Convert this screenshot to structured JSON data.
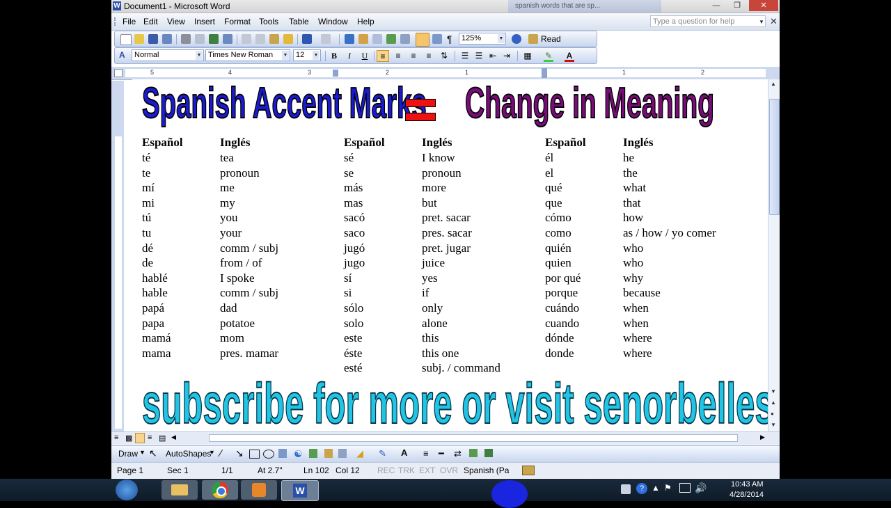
{
  "window": {
    "title": "Document1 - Microsoft Word",
    "bg_tab": "spanish words that are sp..."
  },
  "menu": {
    "items": [
      "File",
      "Edit",
      "View",
      "Insert",
      "Format",
      "Tools",
      "Table",
      "Window",
      "Help"
    ],
    "help_placeholder": "Type a question for help"
  },
  "standard_toolbar": {
    "zoom": "125%",
    "read_label": "Read"
  },
  "formatting_toolbar": {
    "style": "Normal",
    "font": "Times New Roman",
    "size": "12",
    "bold": "B",
    "italic": "I",
    "underline": "U"
  },
  "ruler": {
    "numbers": [
      "5",
      "4",
      "3",
      "2",
      "1",
      "1",
      "2"
    ]
  },
  "document": {
    "title_left": "Spanish Accent Marks",
    "title_right": "Change in Meaning",
    "headers": [
      "Español",
      "Inglés",
      "Español",
      "Inglés",
      "Español",
      "Inglés"
    ],
    "col1_es": [
      "té",
      "te",
      "mí",
      "mi",
      "tú",
      "tu",
      "dé",
      "de",
      "hablé",
      "hable",
      "papá",
      "papa",
      "mamá",
      "mama"
    ],
    "col1_en": [
      "tea",
      "pronoun",
      "me",
      "my",
      "you",
      "your",
      "comm / subj",
      "from / of",
      "I spoke",
      "comm / subj",
      "dad",
      "potatoe",
      "mom",
      "pres. mamar"
    ],
    "col2_es": [
      "sé",
      "se",
      "más",
      "mas",
      "sacó",
      "saco",
      "jugó",
      "jugo",
      "sí",
      "si",
      "sólo",
      "solo",
      "este",
      "éste",
      "esté"
    ],
    "col2_en": [
      "I know",
      "pronoun",
      "more",
      "but",
      "pret. sacar",
      "pres. sacar",
      "pret. jugar",
      "juice",
      "yes",
      "if",
      "only",
      "alone",
      "this",
      "this one",
      "subj. / command"
    ],
    "col3_es": [
      "él",
      "el",
      "qué",
      "que",
      "cómo",
      "como",
      "quién",
      "quien",
      "por qué",
      "porque",
      "cuándo",
      "cuando",
      "dónde",
      "donde"
    ],
    "col3_en": [
      "he",
      "the",
      "what",
      "that",
      "how",
      "as / how / yo comer",
      "who",
      "who",
      "why",
      "because",
      "when",
      "when",
      "where",
      "where"
    ],
    "footer": "subscribe for more or visit senorbelles.com :)"
  },
  "drawbar": {
    "draw": "Draw",
    "autoshapes": "AutoShapes"
  },
  "status": {
    "page": "Page 1",
    "sec": "Sec 1",
    "pages": "1/1",
    "at": "At 2.7\"",
    "ln": "Ln 102",
    "col": "Col 12",
    "rec": "REC",
    "trk": "TRK",
    "ext": "EXT",
    "ovr": "OVR",
    "lang": "Spanish (Pa"
  },
  "taskbar": {
    "time": "10:43 AM",
    "date": "4/28/2014"
  },
  "colors": {
    "title_left": "#1b1bd2",
    "title_right": "#7a0c7a",
    "equals": "#ee1111",
    "footer": "#22c4e4"
  }
}
